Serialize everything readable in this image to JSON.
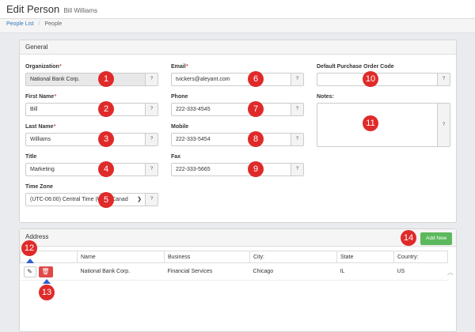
{
  "header": {
    "title": "Edit Person",
    "subtitle": "Bill Williams"
  },
  "breadcrumb": {
    "items": [
      "People List",
      "People"
    ]
  },
  "general": {
    "heading": "General",
    "help_label": "?",
    "organization": {
      "label": "Organization",
      "value": "National Bank Corp."
    },
    "first_name": {
      "label": "First Name",
      "value": "Bill"
    },
    "last_name": {
      "label": "Last Name",
      "value": "Williams"
    },
    "title": {
      "label": "Title",
      "value": "Marketing"
    },
    "time_zone": {
      "label": "Time Zone",
      "value": "(UTC-06:00) Central Time (US & Canad"
    },
    "email": {
      "label": "Email",
      "value": "tvickers@aleyant.com"
    },
    "phone": {
      "label": "Phone",
      "value": "222-333-4545"
    },
    "mobile": {
      "label": "Mobile",
      "value": "222-333-5454"
    },
    "fax": {
      "label": "Fax",
      "value": "222-333-5665"
    },
    "po_code": {
      "label": "Default Purchase Order Code",
      "value": ""
    },
    "notes": {
      "label": "Notes:",
      "value": ""
    },
    "required_mark": "*"
  },
  "address": {
    "heading": "Address",
    "add_new_label": "Add New",
    "columns": [
      "",
      "Name",
      "Business",
      "City:",
      "State",
      "Country:"
    ],
    "rows": [
      {
        "name": "National Bank Corp.",
        "business": "Financial Services",
        "city": "Chicago",
        "state": "IL",
        "country": "US"
      }
    ]
  },
  "callouts": [
    "1",
    "2",
    "3",
    "4",
    "5",
    "6",
    "7",
    "8",
    "9",
    "10",
    "11",
    "12",
    "13",
    "14"
  ],
  "icons": {
    "edit": "edit-icon",
    "delete": "trash-icon",
    "select": "chevron-down-icon",
    "scroll": "scroll-up-icon"
  },
  "colors": {
    "callout": "#e02a2a",
    "add_new": "#5cb85c",
    "delete": "#e04848",
    "arrow": "#2d5fd1",
    "link": "#337ab7"
  }
}
